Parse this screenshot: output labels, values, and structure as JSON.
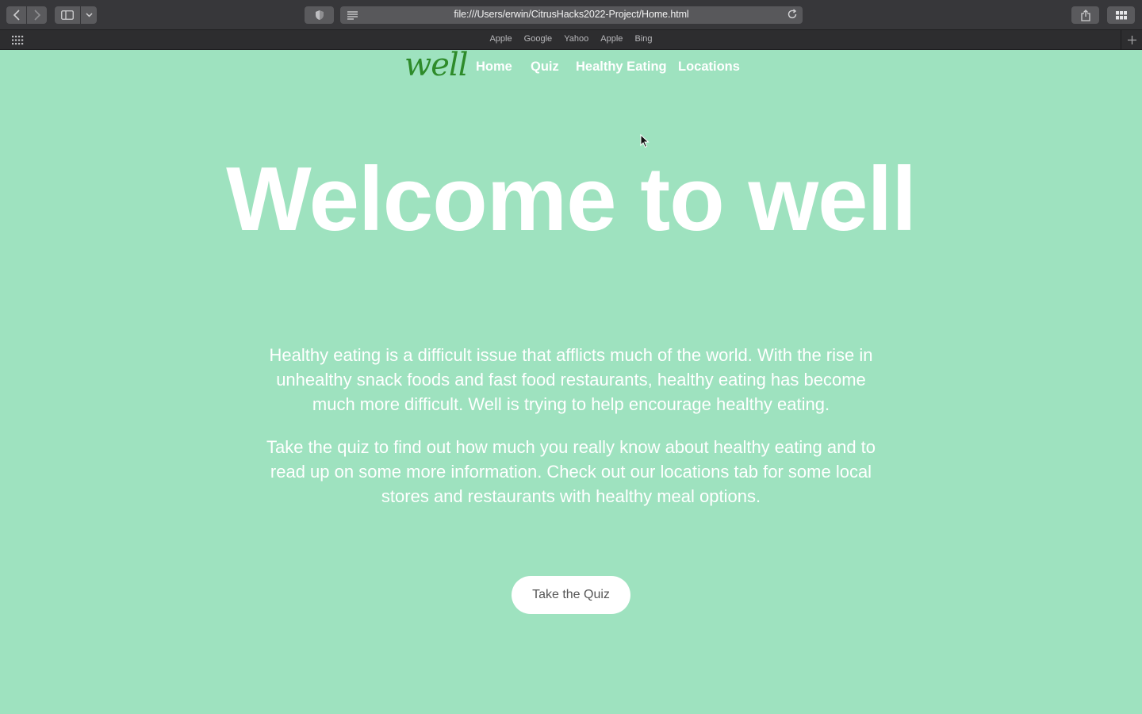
{
  "browser": {
    "url": "file:///Users/erwin/CitrusHacks2022-Project/Home.html",
    "favorites": [
      "Apple",
      "Google",
      "Yahoo",
      "Apple",
      "Bing"
    ],
    "icons": {
      "back": "chevron-left-icon",
      "forward": "chevron-right-icon",
      "sidebar": "sidebar-icon",
      "reader": "reader-icon",
      "reload": "reload-icon",
      "share": "share-icon",
      "tabs": "tab-overview-icon",
      "grid": "grid-icon",
      "add": "plus-icon"
    }
  },
  "site": {
    "logo": "well",
    "nav": {
      "home": "Home",
      "quiz": "Quiz",
      "healthy_eating": "Healthy Eating",
      "locations": "Locations"
    },
    "hero_title": "Welcome to well",
    "paragraphs": [
      "Healthy eating is a difficult issue that afflicts much of the world. With the rise in unhealthy snack foods and fast food restaurants, healthy eating has become much more difficult. Well is trying to help encourage healthy eating.",
      "Take the quiz to find out how much you really know about healthy eating and to read up on some more information. Check out our locations tab for some local stores and restaurants with healthy meal options."
    ],
    "cta_label": "Take the Quiz"
  },
  "colors": {
    "page_background": "#9ee2bf",
    "logo": "#2e8b2a",
    "text": "#ffffff",
    "button_text": "#555555",
    "chrome": "#37373a"
  }
}
